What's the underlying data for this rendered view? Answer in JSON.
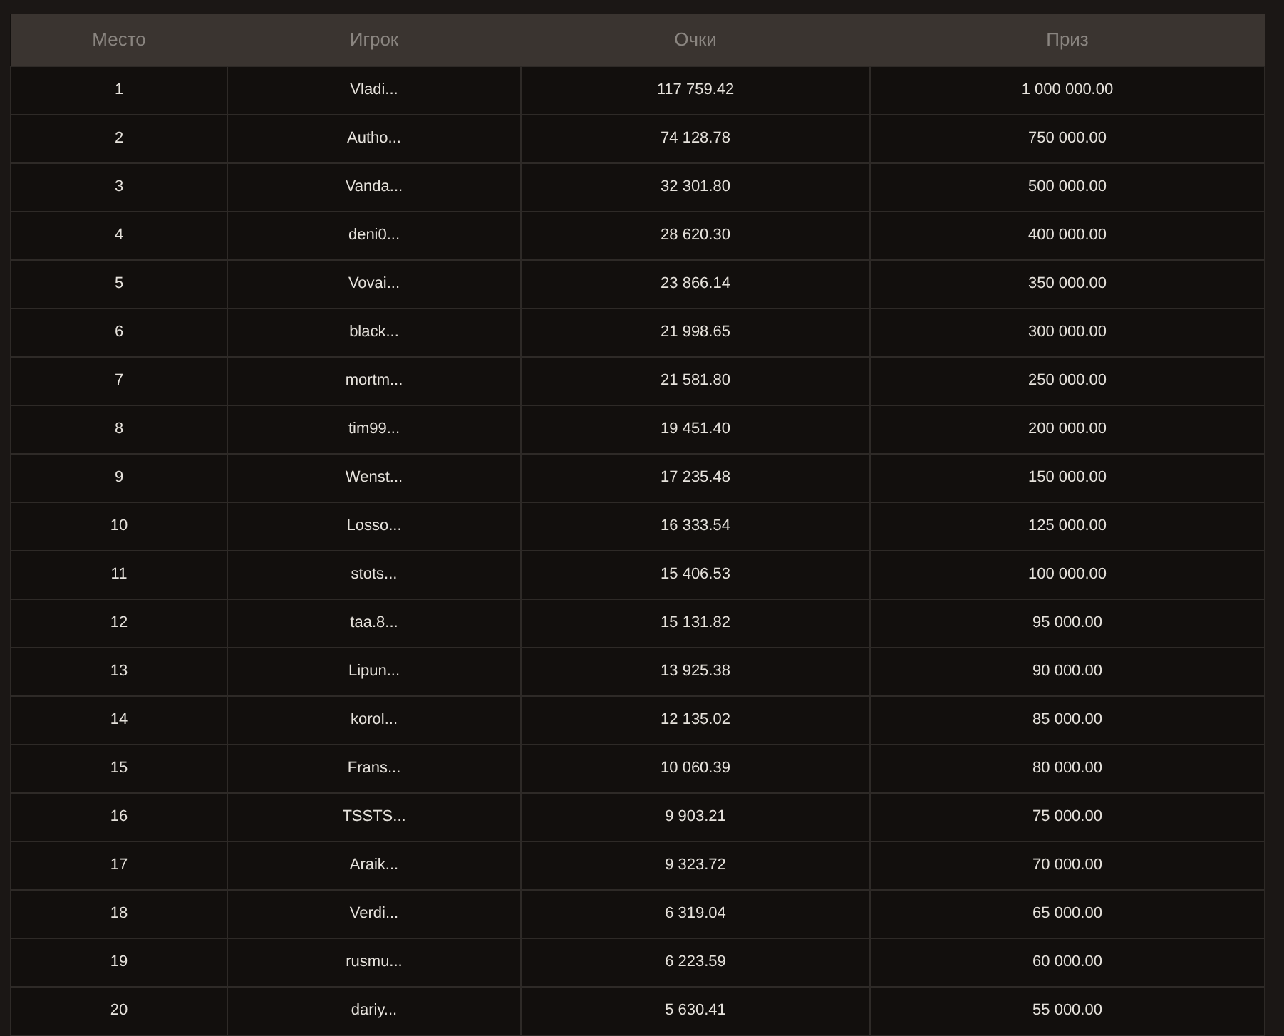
{
  "table": {
    "columns": [
      "Место",
      "Игрок",
      "Очки",
      "Приз"
    ],
    "rows": [
      [
        "1",
        "Vladi...",
        "117 759.42",
        "1 000 000.00"
      ],
      [
        "2",
        "Autho...",
        "74 128.78",
        "750 000.00"
      ],
      [
        "3",
        "Vanda...",
        "32 301.80",
        "500 000.00"
      ],
      [
        "4",
        "deni0...",
        "28 620.30",
        "400 000.00"
      ],
      [
        "5",
        "Vovai...",
        "23 866.14",
        "350 000.00"
      ],
      [
        "6",
        "black...",
        "21 998.65",
        "300 000.00"
      ],
      [
        "7",
        "mortm...",
        "21 581.80",
        "250 000.00"
      ],
      [
        "8",
        "tim99...",
        "19 451.40",
        "200 000.00"
      ],
      [
        "9",
        "Wenst...",
        "17 235.48",
        "150 000.00"
      ],
      [
        "10",
        "Losso...",
        "16 333.54",
        "125 000.00"
      ],
      [
        "11",
        "stots...",
        "15 406.53",
        "100 000.00"
      ],
      [
        "12",
        "taa.8...",
        "15 131.82",
        "95 000.00"
      ],
      [
        "13",
        "Lipun...",
        "13 925.38",
        "90 000.00"
      ],
      [
        "14",
        "korol...",
        "12 135.02",
        "85 000.00"
      ],
      [
        "15",
        "Frans...",
        "10 060.39",
        "80 000.00"
      ],
      [
        "16",
        "TSSTS...",
        "9 903.21",
        "75 000.00"
      ],
      [
        "17",
        "Araik...",
        "9 323.72",
        "70 000.00"
      ],
      [
        "18",
        "Verdi...",
        "6 319.04",
        "65 000.00"
      ],
      [
        "19",
        "rusmu...",
        "6 223.59",
        "60 000.00"
      ],
      [
        "20",
        "dariy...",
        "5 630.41",
        "55 000.00"
      ]
    ]
  }
}
